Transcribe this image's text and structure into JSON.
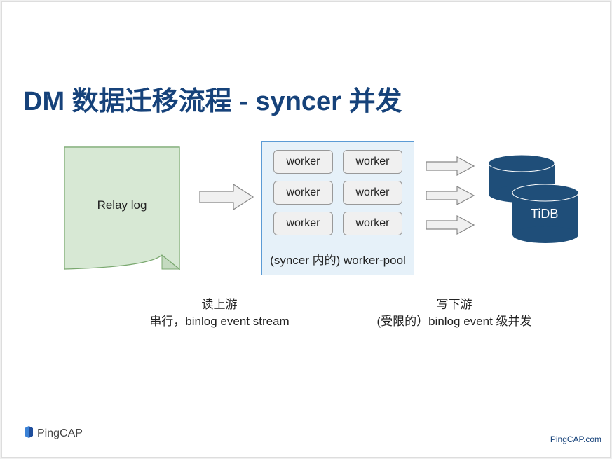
{
  "title": "DM 数据迁移流程 - syncer 并发",
  "relay_log": "Relay log",
  "worker_pool": {
    "worker_label": "worker",
    "pool_label": "(syncer 内的) worker-pool"
  },
  "tidb": "TiDB",
  "captions": {
    "read_title": "读上游",
    "read_desc": "串行，binlog event stream",
    "write_title": "写下游",
    "write_desc": "(受限的）binlog event 级并发"
  },
  "footer": {
    "brand": "PingCAP",
    "link": "PingCAP.com"
  }
}
